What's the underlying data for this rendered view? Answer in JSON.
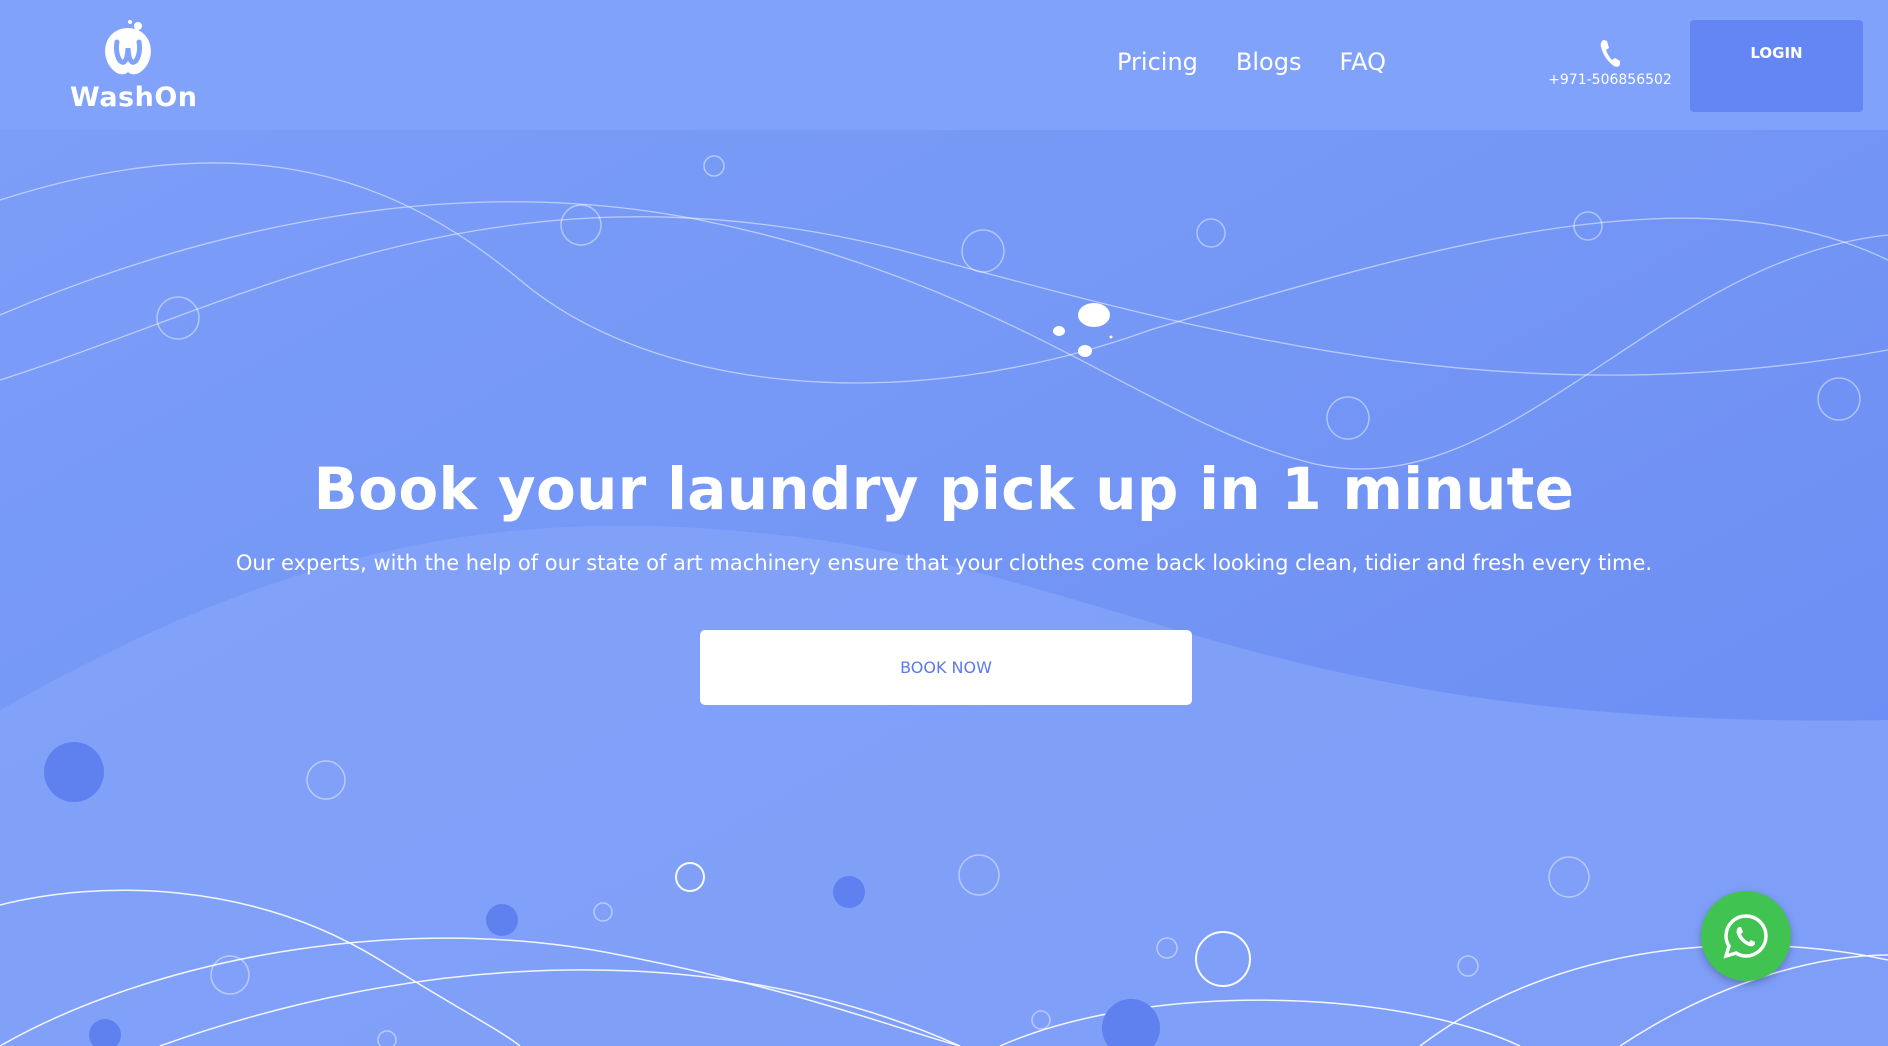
{
  "brand": {
    "name": "WashOn"
  },
  "nav": {
    "items": [
      {
        "label": "Pricing"
      },
      {
        "label": "Blogs"
      },
      {
        "label": "FAQ"
      }
    ]
  },
  "contact": {
    "phone": "+971-506856502",
    "icon": "phone-icon"
  },
  "header": {
    "login_label": "LOGIN"
  },
  "hero": {
    "title": "Book your laundry pick up in 1 minute",
    "subtitle": "Our experts, with the help of our state of art machinery ensure that your clothes come back looking clean, tidier and fresh every time.",
    "cta_label": "BOOK NOW"
  },
  "floating": {
    "icon": "whatsapp-icon"
  },
  "colors": {
    "background": "#7497f5",
    "header": "#80a2fa",
    "login_button": "#6386f4",
    "cta_text": "#5b79e8",
    "whatsapp": "#40c351"
  }
}
